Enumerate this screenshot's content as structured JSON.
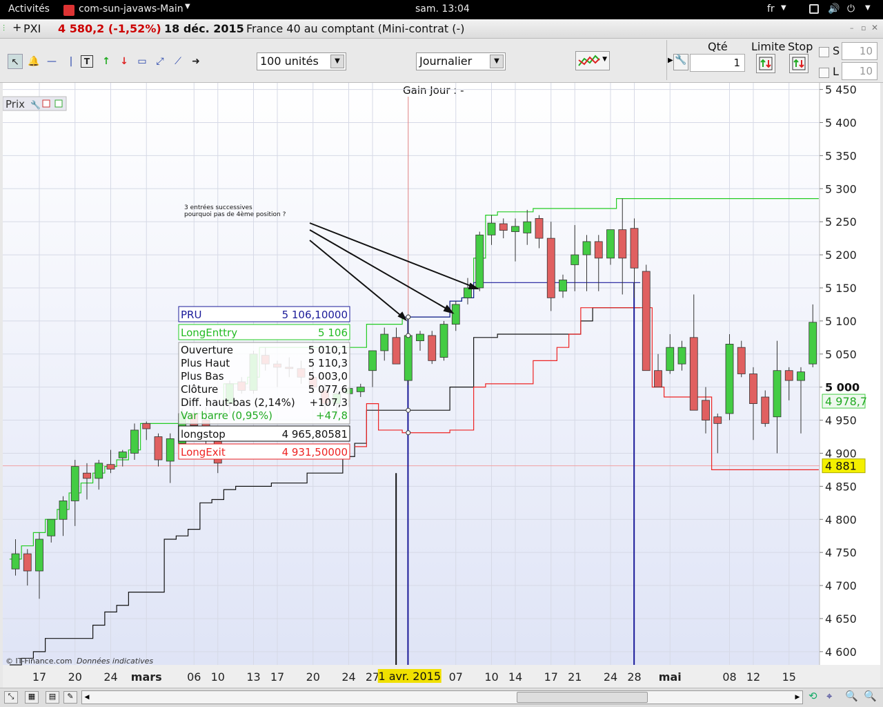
{
  "topbar": {
    "activities": "Activités",
    "app": "com-sun-javaws-Main",
    "clock": "sam. 13:04",
    "lang": "fr"
  },
  "header": {
    "symbol": "PXI",
    "price_change": "4 580,2 (-1,52%)",
    "date": "18 déc. 2015",
    "name": "France 40 au comptant (Mini-contrat  (-)"
  },
  "toolbar": {
    "units": "100 unités",
    "period": "Journalier",
    "qty_label": "Qté",
    "qty_value": "1",
    "limit_label": "Limite",
    "stop_label": "Stop",
    "s_label": "S",
    "s_value": "10",
    "l_label": "L",
    "l_value": "10"
  },
  "colors": {
    "up": "#44cc44",
    "down": "#e06060",
    "entry": "#22cc22",
    "pru": "#1a1a99",
    "longstop": "#111111",
    "exit": "#ee2222"
  },
  "chart_data": {
    "type": "candlestick",
    "title": "Gain Jour : -",
    "panel_label": "Prix",
    "copyright": "© IT-Finance.com",
    "copyright_note": "Données indicatives",
    "annotation": [
      "3 entrées successives",
      "pourquoi pas de 4ème position ?"
    ],
    "ylim": [
      4580,
      5460
    ],
    "y_ticks": [
      4600,
      4650,
      4700,
      4750,
      4800,
      4850,
      4900,
      4950,
      5000,
      5050,
      5100,
      5150,
      5200,
      5250,
      5300,
      5350,
      5400,
      5450
    ],
    "y_tick_labels": [
      "4 600",
      "4 650",
      "4 700",
      "4 750",
      "4 800",
      "4 850",
      "4 900",
      "4 950",
      "5 000",
      "5 050",
      "5 100",
      "5 150",
      "5 200",
      "5 250",
      "5 300",
      "5 350",
      "5 400",
      "5 450"
    ],
    "x_labels": [
      "17",
      "20",
      "24",
      "mars",
      "06",
      "10",
      "13",
      "17",
      "20",
      "24",
      "27",
      "07",
      "10",
      "14",
      "17",
      "21",
      "24",
      "28",
      "mai",
      "08",
      "12",
      "15"
    ],
    "x_label_bars": [
      2,
      5,
      8,
      11,
      15,
      17,
      20,
      22,
      25,
      28,
      30,
      37,
      40,
      42,
      45,
      47,
      50,
      52,
      55,
      60,
      62,
      65
    ],
    "cursor_label": "1 avr. 2015",
    "cursor_bar": 33,
    "price_tags": [
      {
        "label": "5 000",
        "value": 5000
      },
      {
        "label": "4 978,7",
        "value": 4978.7
      },
      {
        "label": "4 881",
        "value": 4881
      }
    ],
    "candles": [
      {
        "o": 4725,
        "h": 4770,
        "l": 4715,
        "c": 4748
      },
      {
        "o": 4748,
        "h": 4755,
        "l": 4700,
        "c": 4722
      },
      {
        "o": 4722,
        "h": 4780,
        "l": 4680,
        "c": 4770
      },
      {
        "o": 4775,
        "h": 4800,
        "l": 4765,
        "c": 4800
      },
      {
        "o": 4800,
        "h": 4835,
        "l": 4775,
        "c": 4828
      },
      {
        "o": 4828,
        "h": 4890,
        "l": 4790,
        "c": 4880
      },
      {
        "o": 4870,
        "h": 4885,
        "l": 4830,
        "c": 4862
      },
      {
        "o": 4862,
        "h": 4890,
        "l": 4845,
        "c": 4885
      },
      {
        "o": 4883,
        "h": 4905,
        "l": 4870,
        "c": 4876
      },
      {
        "o": 4893,
        "h": 4905,
        "l": 4880,
        "c": 4902
      },
      {
        "o": 4900,
        "h": 4945,
        "l": 4890,
        "c": 4935
      },
      {
        "o": 4945,
        "h": 4948,
        "l": 4920,
        "c": 4937
      },
      {
        "o": 4925,
        "h": 4930,
        "l": 4880,
        "c": 4890
      },
      {
        "o": 4888,
        "h": 4930,
        "l": 4855,
        "c": 4922
      },
      {
        "o": 4915,
        "h": 4968,
        "l": 4900,
        "c": 4960
      },
      {
        "o": 4960,
        "h": 4985,
        "l": 4935,
        "c": 4942
      },
      {
        "o": 4950,
        "h": 4970,
        "l": 4900,
        "c": 4920
      },
      {
        "o": 4918,
        "h": 4940,
        "l": 4870,
        "c": 4885
      },
      {
        "o": 4975,
        "h": 5010,
        "l": 4960,
        "c": 5005
      },
      {
        "o": 5008,
        "h": 5015,
        "l": 4990,
        "c": 4995
      },
      {
        "o": 4995,
        "h": 5055,
        "l": 4990,
        "c": 5050
      },
      {
        "o": 5048,
        "h": 5060,
        "l": 5025,
        "c": 5035
      },
      {
        "o": 5035,
        "h": 5040,
        "l": 5000,
        "c": 5030
      },
      {
        "o": 5030,
        "h": 5045,
        "l": 5015,
        "c": 5028
      },
      {
        "o": 5028,
        "h": 5040,
        "l": 5005,
        "c": 5015
      },
      {
        "o": 5015,
        "h": 5030,
        "l": 4990,
        "c": 5000
      },
      {
        "o": 4995,
        "h": 5005,
        "l": 4960,
        "c": 4975
      },
      {
        "o": 4975,
        "h": 5000,
        "l": 4955,
        "c": 4990
      },
      {
        "o": 4990,
        "h": 5000,
        "l": 4970,
        "c": 4998
      },
      {
        "o": 4993,
        "h": 5005,
        "l": 4985,
        "c": 5000
      },
      {
        "o": 5025,
        "h": 5045,
        "l": 5000,
        "c": 5055
      },
      {
        "o": 5055,
        "h": 5090,
        "l": 5040,
        "c": 5080
      },
      {
        "o": 5075,
        "h": 5090,
        "l": 5040,
        "c": 5035
      },
      {
        "o": 5010,
        "h": 5110,
        "l": 5003,
        "c": 5078
      },
      {
        "o": 5070,
        "h": 5085,
        "l": 5055,
        "c": 5080
      },
      {
        "o": 5078,
        "h": 5085,
        "l": 5035,
        "c": 5040
      },
      {
        "o": 5045,
        "h": 5100,
        "l": 5040,
        "c": 5095
      },
      {
        "o": 5095,
        "h": 5130,
        "l": 5085,
        "c": 5125
      },
      {
        "o": 5135,
        "h": 5165,
        "l": 5125,
        "c": 5150
      },
      {
        "o": 5150,
        "h": 5235,
        "l": 5145,
        "c": 5230
      },
      {
        "o": 5230,
        "h": 5260,
        "l": 5215,
        "c": 5248
      },
      {
        "o": 5247,
        "h": 5255,
        "l": 5225,
        "c": 5237
      },
      {
        "o": 5235,
        "h": 5255,
        "l": 5190,
        "c": 5243
      },
      {
        "o": 5233,
        "h": 5268,
        "l": 5215,
        "c": 5250
      },
      {
        "o": 5255,
        "h": 5260,
        "l": 5210,
        "c": 5225
      },
      {
        "o": 5225,
        "h": 5250,
        "l": 5115,
        "c": 5135
      },
      {
        "o": 5145,
        "h": 5170,
        "l": 5135,
        "c": 5162
      },
      {
        "o": 5185,
        "h": 5245,
        "l": 5145,
        "c": 5200
      },
      {
        "o": 5200,
        "h": 5230,
        "l": 5145,
        "c": 5220
      },
      {
        "o": 5220,
        "h": 5230,
        "l": 5145,
        "c": 5195
      },
      {
        "o": 5195,
        "h": 5215,
        "l": 5185,
        "c": 5238
      },
      {
        "o": 5238,
        "h": 5285,
        "l": 5140,
        "c": 5195
      },
      {
        "o": 5240,
        "h": 5255,
        "l": 5135,
        "c": 5180
      },
      {
        "o": 5175,
        "h": 5185,
        "l": 5080,
        "c": 5025
      },
      {
        "o": 5025,
        "h": 5050,
        "l": 5005,
        "c": 5000
      },
      {
        "o": 5025,
        "h": 5080,
        "l": 5020,
        "c": 5060
      },
      {
        "o": 5035,
        "h": 5070,
        "l": 5025,
        "c": 5060
      },
      {
        "o": 5075,
        "h": 5140,
        "l": 4995,
        "c": 4965
      },
      {
        "o": 4980,
        "h": 5000,
        "l": 4930,
        "c": 4950
      },
      {
        "o": 4955,
        "h": 4960,
        "l": 4900,
        "c": 4945
      },
      {
        "o": 4960,
        "h": 5080,
        "l": 4950,
        "c": 5065
      },
      {
        "o": 5060,
        "h": 5070,
        "l": 5015,
        "c": 5020
      },
      {
        "o": 5020,
        "h": 5030,
        "l": 4920,
        "c": 4975
      },
      {
        "o": 4985,
        "h": 4995,
        "l": 4940,
        "c": 4945
      },
      {
        "o": 4955,
        "h": 5070,
        "l": 4900,
        "c": 5025
      },
      {
        "o": 5025,
        "h": 5030,
        "l": 4980,
        "c": 5010
      },
      {
        "o": 5010,
        "h": 5030,
        "l": 4930,
        "c": 5023
      },
      {
        "o": 5035,
        "h": 5125,
        "l": 5030,
        "c": 5098
      }
    ],
    "series": [
      {
        "name": "LongEnttry",
        "values": [
          4740,
          4760,
          4780,
          4800,
          4815,
          4840,
          4855,
          4870,
          4880,
          4890,
          4905,
          4945,
          4945,
          4945,
          4945,
          4960,
          4960,
          4960,
          5005,
          5005,
          5015,
          5060,
          5060,
          5060,
          5060,
          5060,
          5060,
          5060,
          5060,
          5060,
          5095,
          5095,
          5095,
          5106,
          5106,
          5106,
          5106,
          5130,
          5135,
          5195,
          5260,
          5265,
          5265,
          5265,
          5270,
          5270,
          5270,
          5270,
          5270,
          5270,
          5270,
          5285,
          5285,
          5285,
          5285,
          5285,
          5285,
          5285,
          5285,
          5285,
          5285,
          5285,
          5285,
          5285,
          5285,
          5285,
          5285,
          5285
        ]
      },
      {
        "name": "PRU",
        "values": [
          null,
          null,
          null,
          null,
          null,
          null,
          null,
          null,
          null,
          null,
          null,
          null,
          null,
          null,
          null,
          null,
          null,
          null,
          null,
          null,
          null,
          null,
          null,
          null,
          null,
          null,
          null,
          null,
          null,
          null,
          null,
          null,
          null,
          5106,
          5106,
          5106,
          5106,
          5130,
          5135,
          5158,
          5158,
          5158,
          5158,
          5158,
          5158,
          5158,
          5158,
          5158,
          5158,
          5158,
          5158,
          5158,
          5158,
          null,
          null,
          null,
          null,
          null,
          null,
          null,
          null,
          null,
          null,
          null,
          null,
          null,
          null,
          null
        ]
      },
      {
        "name": "longstop",
        "values": [
          4580,
          4590,
          4600,
          4620,
          4620,
          4620,
          4620,
          4640,
          4660,
          4670,
          4690,
          4690,
          4690,
          4770,
          4775,
          4785,
          4825,
          4830,
          4845,
          4850,
          4850,
          4850,
          4855,
          4855,
          4855,
          4870,
          4870,
          4870,
          4895,
          4915,
          4965,
          4965,
          4965,
          4965,
          4965,
          4965,
          4965,
          5000,
          5000,
          5075,
          5075,
          5080,
          5080,
          5080,
          5080,
          5080,
          5080,
          5080,
          5100,
          5120,
          5120,
          5120,
          5120,
          null,
          null,
          null,
          null,
          null,
          null,
          null,
          null,
          null,
          null,
          null,
          null,
          null,
          null,
          null
        ]
      },
      {
        "name": "LongExit",
        "values": [
          null,
          null,
          null,
          null,
          null,
          null,
          null,
          null,
          null,
          null,
          null,
          null,
          null,
          null,
          null,
          null,
          null,
          null,
          null,
          null,
          null,
          null,
          null,
          null,
          null,
          null,
          null,
          null,
          null,
          4910,
          4975,
          4935,
          4935,
          4931,
          4931,
          4931,
          4931,
          4935,
          4935,
          5000,
          5005,
          5005,
          5005,
          5005,
          5040,
          5040,
          5060,
          5080,
          5120,
          5120,
          5120,
          5120,
          5120,
          5120,
          5000,
          4985,
          4985,
          4985,
          4985,
          4875,
          4875,
          4875,
          4875,
          4875,
          4875,
          4875,
          4875,
          4875
        ]
      }
    ],
    "tooltip": {
      "pru": {
        "label": "PRU",
        "value": "5 106,10000"
      },
      "entry": {
        "label": "LongEnttry",
        "value": "5 106"
      },
      "rows": [
        {
          "label": "Ouverture",
          "value": "5 010,1"
        },
        {
          "label": "Plus Haut",
          "value": "5 110,3"
        },
        {
          "label": "Plus Bas",
          "value": "5 003,0"
        },
        {
          "label": "Clôture",
          "value": "5 077,6"
        },
        {
          "label": "Diff. haut-bas (2,14%)",
          "value": "+107,3"
        },
        {
          "label": "Var barre (0,95%)",
          "value": "+47,8"
        }
      ],
      "longstop": {
        "label": "longstop",
        "value": "4 965,80581"
      },
      "exit": {
        "label": "LongExit",
        "value": "4 931,50000"
      }
    }
  }
}
